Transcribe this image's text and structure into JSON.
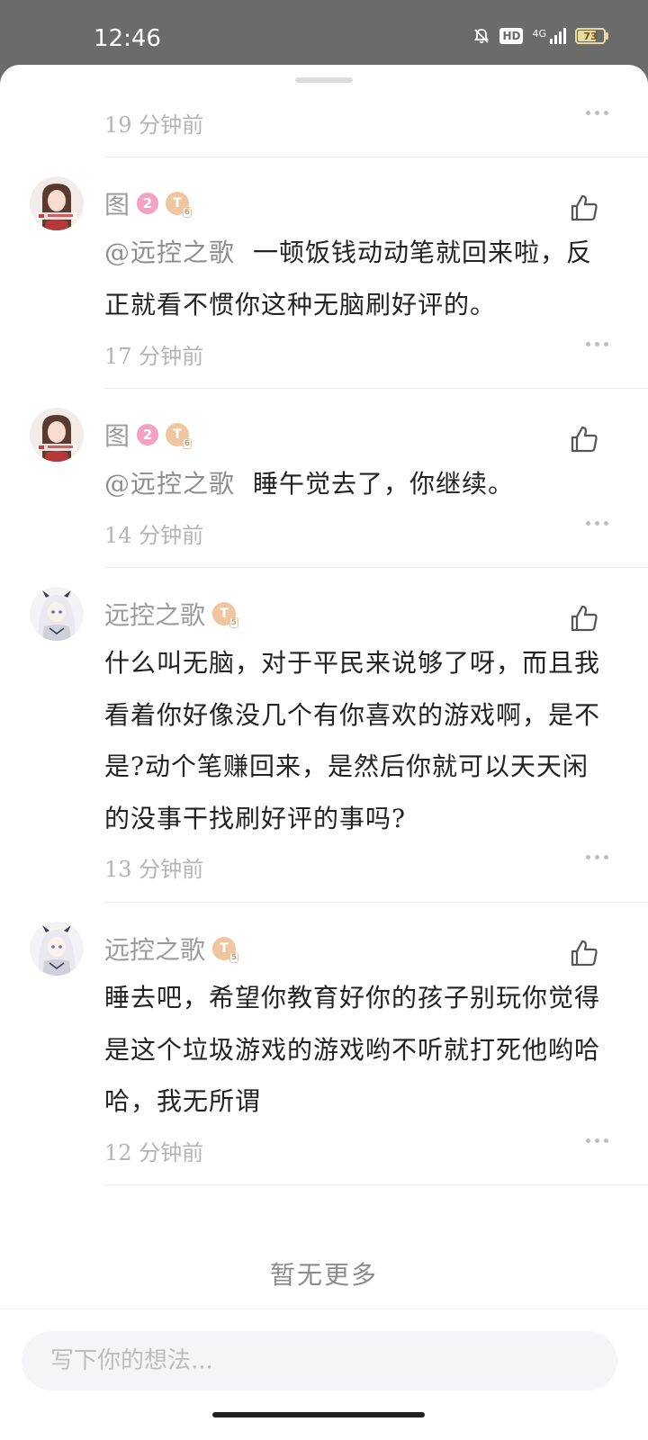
{
  "status_bar": {
    "time": "12:46",
    "network": "4G",
    "hd": "HD",
    "battery": "73"
  },
  "header_time": {
    "time": "19 分钟前"
  },
  "comments": [
    {
      "username": "图",
      "level": "2",
      "badge": "T",
      "badge_sub": "6",
      "mention": "@远控之歌",
      "text": "一顿饭钱动动笔就回来啦，反正就看不惯你这种无脑刷好评的。",
      "time": "17 分钟前"
    },
    {
      "username": "图",
      "level": "2",
      "badge": "T",
      "badge_sub": "6",
      "mention": "@远控之歌",
      "text": "睡午觉去了，你继续。",
      "time": "14 分钟前"
    },
    {
      "username": "远控之歌",
      "badge": "T",
      "badge_sub": "5",
      "text": "什么叫无脑，对于平民来说够了呀，而且我看着你好像没几个有你喜欢的游戏啊，是不是?动个笔赚回来，是然后你就可以天天闲的没事干找刷好评的事吗?",
      "time": "13 分钟前"
    },
    {
      "username": "远控之歌",
      "badge": "T",
      "badge_sub": "5",
      "text": "睡去吧，希望你教育好你的孩子别玩你觉得是这个垃圾游戏的游戏哟不听就打死他哟哈哈，我无所谓",
      "time": "12 分钟前"
    }
  ],
  "footer": {
    "no_more": "暂无更多"
  },
  "input": {
    "placeholder": "写下你的想法..."
  }
}
